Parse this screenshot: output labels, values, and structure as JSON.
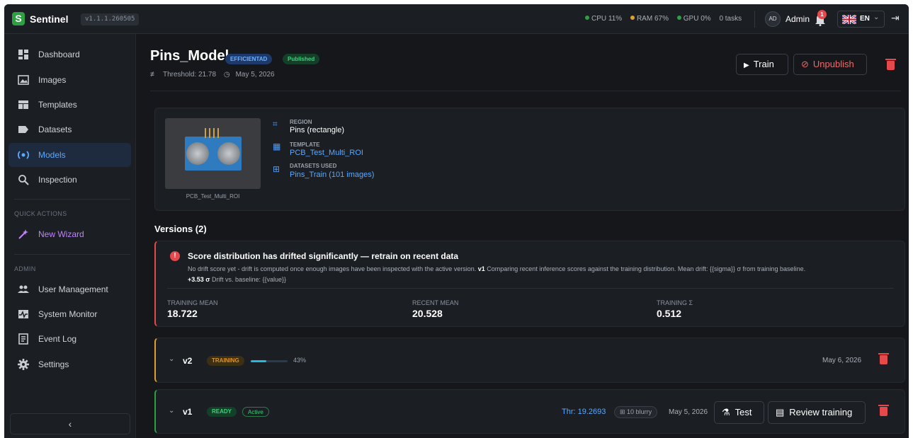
{
  "app": {
    "name": "Sentinel",
    "logo_letter": "S",
    "version": "v1.1.1.260505"
  },
  "status": {
    "cpu": "CPU 11%",
    "ram": "RAM 67%",
    "gpu": "GPU 0%",
    "tasks": "0 tasks",
    "colors": {
      "cpu": "#2ea043",
      "ram": "#e0a030",
      "gpu": "#2ea043"
    }
  },
  "user": {
    "initials": "AD",
    "name": "Admin",
    "notifications": "1",
    "lang": "EN"
  },
  "sidebar": {
    "items": [
      {
        "label": "Dashboard",
        "icon": "dashboard-icon"
      },
      {
        "label": "Images",
        "icon": "image-icon"
      },
      {
        "label": "Templates",
        "icon": "template-icon"
      },
      {
        "label": "Datasets",
        "icon": "label-icon"
      },
      {
        "label": "Models",
        "icon": "model-icon"
      },
      {
        "label": "Inspection",
        "icon": "search-icon"
      }
    ],
    "quick_actions_title": "QUICK ACTIONS",
    "wizard_label": "New Wizard",
    "admin_title": "ADMIN",
    "admin_items": [
      {
        "label": "User Management",
        "icon": "users-icon"
      },
      {
        "label": "System Monitor",
        "icon": "monitor-icon"
      },
      {
        "label": "Event Log",
        "icon": "log-icon"
      },
      {
        "label": "Settings",
        "icon": "gear-icon"
      }
    ]
  },
  "model": {
    "name": "Pins_Model",
    "type_badge": "EFFICIENTAD",
    "status_badge": "Published",
    "threshold": "Threshold: 21.78",
    "date": "May 5, 2026",
    "train_label": "Train",
    "unpublish_label": "Unpublish"
  },
  "info": {
    "thumb_caption": "PCB_Test_Multi_ROI",
    "region_label": "REGION",
    "region_value": "Pins (rectangle)",
    "template_label": "TEMPLATE",
    "template_value": "PCB_Test_Multi_ROI",
    "datasets_label": "DATASETS USED",
    "datasets_value": "Pins_Train (101 images)"
  },
  "versions": {
    "title": "Versions (2)",
    "alert": {
      "title": "Score distribution has drifted significantly — retrain on recent data",
      "desc_1": "No drift score yet - drift is computed once enough images have been inspected with the active version.",
      "desc_version": "v1",
      "desc_2": "Comparing recent inference scores against the training distribution. Mean drift: {{sigma}} σ from training baseline.",
      "desc_sigma": "+3.53 σ",
      "desc_3": "Drift vs. baseline: {{value}}",
      "training_mean_label": "TRAINING MEAN",
      "training_mean": "18.722",
      "recent_mean_label": "RECENT MEAN",
      "recent_mean": "20.528",
      "training_sigma_label": "TRAINING Σ",
      "training_sigma": "0.512"
    },
    "rows": [
      {
        "name": "v2",
        "status": "TRAINING",
        "progress": 0.43,
        "progress_label": "43%",
        "date": "May 6, 2026"
      },
      {
        "name": "v1",
        "status": "READY",
        "active": "Active",
        "threshold": "Thr: 19.2693",
        "blurry": "10 blurry",
        "date": "May 5, 2026",
        "test_label": "Test",
        "review_label": "Review training"
      }
    ]
  }
}
